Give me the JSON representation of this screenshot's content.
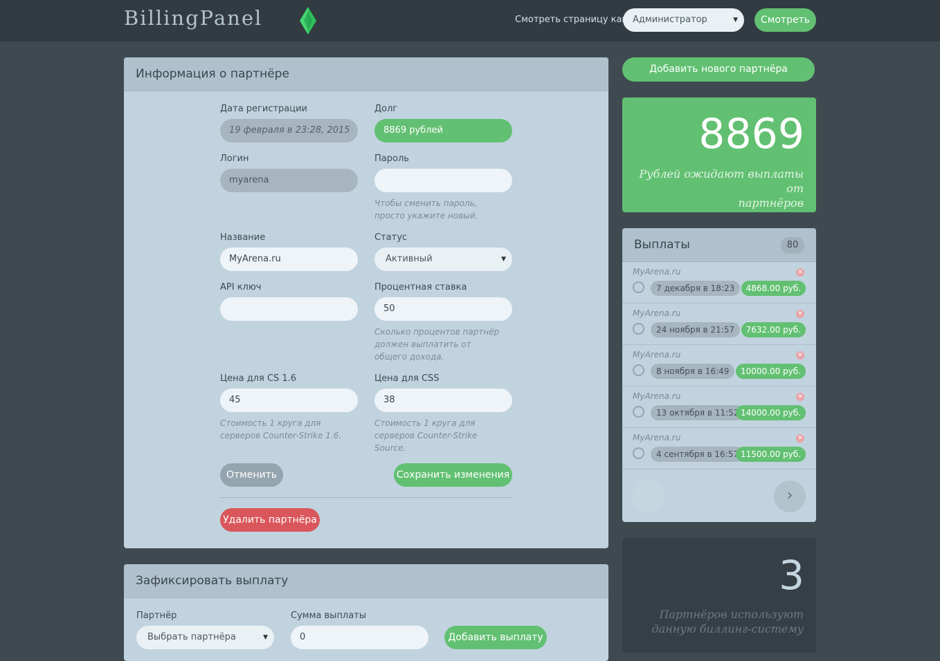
{
  "header": {
    "logo": "BillingPanel",
    "view_as_label": "Смотреть страницу как",
    "role_select": "Администратор",
    "view_button": "Смотреть"
  },
  "partner_info": {
    "title": "Информация о партнёре",
    "reg_date_label": "Дата регистрации",
    "reg_date_value": "19 февраля в 23:28, 2015",
    "debt_label": "Долг",
    "debt_value": "8869 рублей",
    "login_label": "Логин",
    "login_value": "myarena",
    "password_label": "Пароль",
    "password_value": "",
    "password_hint_1": "Чтобы сменить пароль,",
    "password_hint_2": "просто укажите новый.",
    "name_label": "Название",
    "name_value": "MyArena.ru",
    "status_label": "Статус",
    "status_value": "Активный",
    "api_label": "API ключ",
    "api_value": "",
    "rate_label": "Процентная ставка",
    "rate_value": "50",
    "rate_hint_1": "Сколько процентов партнёр",
    "rate_hint_2": "должен выплатить от",
    "rate_hint_3": "общего дохода.",
    "cs16_label": "Цена для CS 1.6",
    "cs16_value": "45",
    "cs16_hint_1": "Стоимость 1 круга для",
    "cs16_hint_2": "серверов Counter-Strike 1.6.",
    "css_label": "Цена для CSS",
    "css_value": "38",
    "css_hint_1": "Стоимость 1 круга для",
    "css_hint_2": "серверов Counter-Strike",
    "css_hint_3": "Source.",
    "cancel_button": "Отменить",
    "save_button": "Сохранить изменения",
    "delete_button": "Удалить партнёра"
  },
  "fix_payment": {
    "title": "Зафиксировать выплату",
    "partner_label": "Партнёр",
    "partner_select": "Выбрать партнёра",
    "sum_label": "Сумма выплаты",
    "sum_value": "0",
    "add_button": "Добавить выплату"
  },
  "sidebar": {
    "add_partner_button": "Добавить нового партнёра",
    "debt_total": "8869",
    "debt_caption_1": "Рублей ожидают выплаты от",
    "debt_caption_2": "партнёров",
    "payouts_title": "Выплаты",
    "payouts_count": "80",
    "payouts": [
      {
        "partner": "MyArena.ru",
        "date": "7 декабря в 18:23",
        "amount": "4868.00 руб."
      },
      {
        "partner": "MyArena.ru",
        "date": "24 ноября в 21:57",
        "amount": "7632.00 руб."
      },
      {
        "partner": "MyArena.ru",
        "date": "8 ноября в 16:49",
        "amount": "10000.00 руб."
      },
      {
        "partner": "MyArena.ru",
        "date": "13 октября в 11:52",
        "amount": "14000.00 руб."
      },
      {
        "partner": "MyArena.ru",
        "date": "4 сентября в 16:57",
        "amount": "11500.00 руб."
      }
    ],
    "partners_count": "3",
    "partners_caption_1": "Партнёров используют",
    "partners_caption_2": "данную биллинг-систему"
  },
  "colors": {
    "accent_green": "#62c072",
    "danger_red": "#d9565a",
    "panel_bg": "#c1d3df",
    "page_bg": "#3e4a50"
  }
}
